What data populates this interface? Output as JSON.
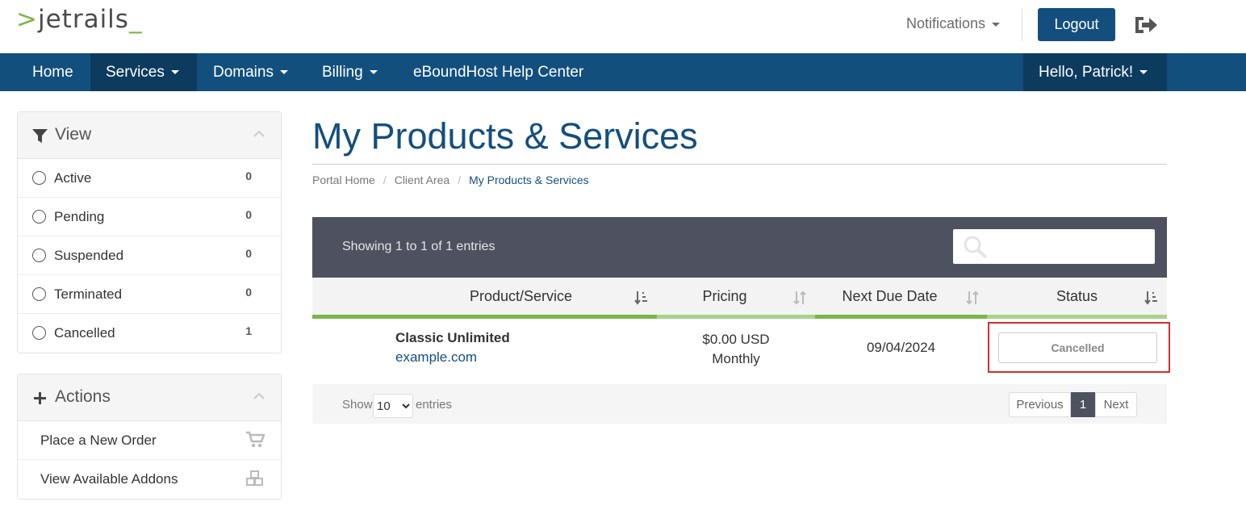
{
  "brand": {
    "prefix": ">",
    "name": "jetrails",
    "suffix": "_",
    "accent_color": "#7ab648"
  },
  "header": {
    "notifications_label": "Notifications",
    "logout_label": "Logout",
    "exit_icon": "sign-out-icon"
  },
  "nav": {
    "items": [
      {
        "label": "Home"
      },
      {
        "label": "Services"
      },
      {
        "label": "Domains"
      },
      {
        "label": "Billing"
      },
      {
        "label": "eBoundHost Help Center"
      }
    ],
    "user_label": "Hello, Patrick!",
    "color": "#124f7d"
  },
  "sidebar": {
    "view": {
      "title": "View",
      "items": [
        {
          "label": "Active",
          "count": "0"
        },
        {
          "label": "Pending",
          "count": "0"
        },
        {
          "label": "Suspended",
          "count": "0"
        },
        {
          "label": "Terminated",
          "count": "0"
        },
        {
          "label": "Cancelled",
          "count": "1"
        }
      ]
    },
    "actions": {
      "title": "Actions",
      "items": [
        {
          "label": "Place a New Order",
          "icon": "cart-icon"
        },
        {
          "label": "View Available Addons",
          "icon": "cubes-icon"
        }
      ]
    }
  },
  "main": {
    "title": "My Products & Services",
    "breadcrumb": [
      "Portal Home",
      "Client Area",
      "My Products & Services"
    ],
    "showing": "Showing 1 to 1 of 1 entries",
    "columns": [
      "Product/Service",
      "Pricing",
      "Next Due Date",
      "Status"
    ],
    "rows": [
      {
        "product": "Classic Unlimited",
        "domain": "example.com",
        "price": "$0.00 USD",
        "cycle": "Monthly",
        "due": "09/04/2024",
        "status": "Cancelled"
      }
    ],
    "footer": {
      "show_label": "Show",
      "page_size": "10",
      "entries_label": "entries",
      "prev_label": "Previous",
      "current_page": "1",
      "next_label": "Next"
    }
  }
}
